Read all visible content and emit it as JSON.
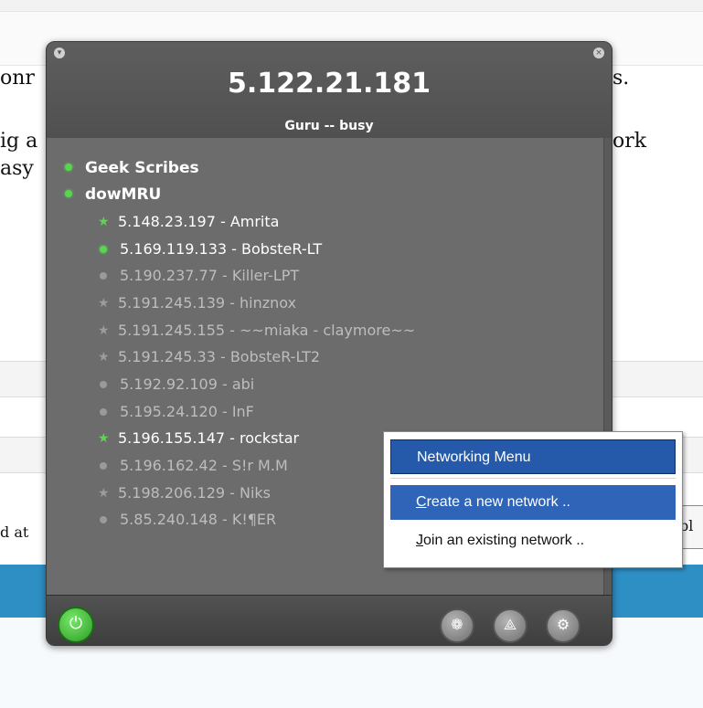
{
  "background": {
    "lines": [
      "onr",
      "s.",
      "ig a",
      "ork",
      "asy",
      "d at",
      "bl"
    ]
  },
  "window": {
    "ip": "5.122.21.181",
    "status": "Guru -- busy",
    "networks": [
      {
        "name": "Geek Scribes",
        "status_icon": "green-dot-icon"
      },
      {
        "name": "dowMRU",
        "status_icon": "green-dot-icon"
      }
    ],
    "peers": [
      {
        "label": "5.148.23.197 - Amrita",
        "icon": "star-icon",
        "state": "online"
      },
      {
        "label": "5.169.119.133 - BobsteR-LT",
        "icon": "dot-icon",
        "state": "online"
      },
      {
        "label": "5.190.237.77 - Killer-LPT",
        "icon": "dot-icon",
        "state": "offline"
      },
      {
        "label": "5.191.245.139 - hinznox",
        "icon": "star-icon",
        "state": "offline"
      },
      {
        "label": "5.191.245.155 - ~~miaka - claymore~~",
        "icon": "star-icon",
        "state": "offline"
      },
      {
        "label": "5.191.245.33 - BobsteR-LT2",
        "icon": "star-icon",
        "state": "offline"
      },
      {
        "label": "5.192.92.109 - abi",
        "icon": "dot-icon",
        "state": "offline"
      },
      {
        "label": "5.195.24.120 - InF",
        "icon": "dot-icon",
        "state": "offline"
      },
      {
        "label": "5.196.155.147 - rockstar",
        "icon": "star-icon",
        "state": "online"
      },
      {
        "label": "5.196.162.42 - S!r M.M",
        "icon": "dot-icon",
        "state": "offline"
      },
      {
        "label": "5.198.206.129 - Niks",
        "icon": "star-icon",
        "state": "offline"
      },
      {
        "label": "5.85.240.148 - K!¶ER",
        "icon": "dot-icon",
        "state": "offline"
      }
    ],
    "footer_icons": [
      "power-icon",
      "paw-icon",
      "network-icon",
      "gear-icon"
    ]
  },
  "context_menu": {
    "title": "Networking Menu",
    "items": [
      {
        "label": "Create a new network ..",
        "underline": "C"
      },
      {
        "label": "Join an existing network ..",
        "underline": "J"
      }
    ]
  },
  "colors": {
    "window_bg": "#6a6a6a",
    "online": "#57d64e",
    "menu_highlight": "#2f64b8",
    "page_blue_bar": "#2e8fc4"
  }
}
